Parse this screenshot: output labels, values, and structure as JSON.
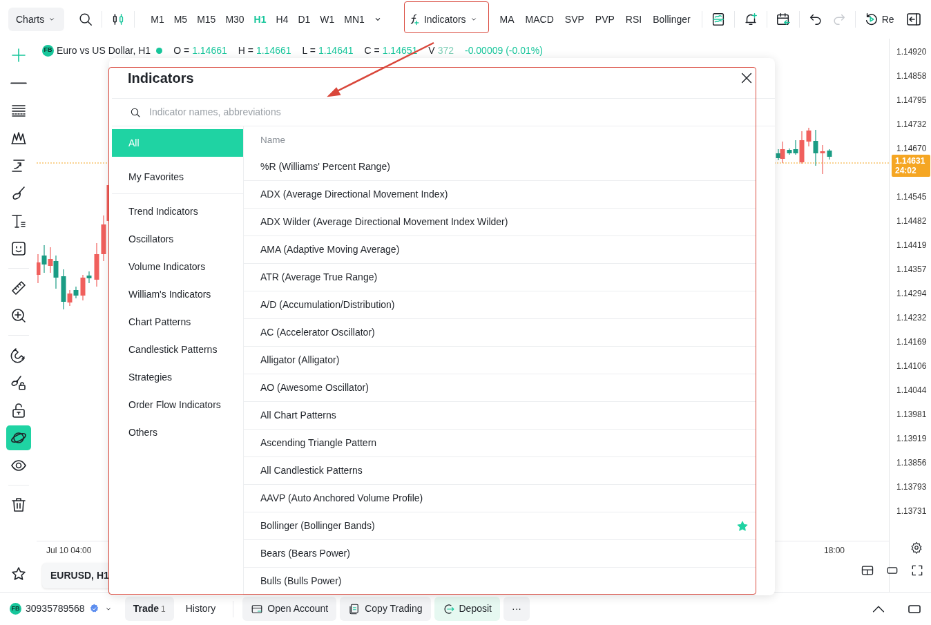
{
  "toolbar": {
    "charts_menu": "Charts",
    "timeframes": [
      {
        "label": "M1",
        "selected": false
      },
      {
        "label": "M5",
        "selected": false
      },
      {
        "label": "M15",
        "selected": false
      },
      {
        "label": "M30",
        "selected": false
      },
      {
        "label": "H1",
        "selected": true
      },
      {
        "label": "H4",
        "selected": false
      },
      {
        "label": "D1",
        "selected": false
      },
      {
        "label": "W1",
        "selected": false
      },
      {
        "label": "MN1",
        "selected": false
      }
    ],
    "indicators_button": "Indicators",
    "quick_indicators": [
      "MA",
      "MACD",
      "SVP",
      "PVP",
      "RSI",
      "Bollinger"
    ],
    "icons": [
      {
        "kind": "layout",
        "disabled": false
      },
      {
        "kind": "alert",
        "disabled": false
      },
      {
        "kind": "calendar",
        "disabled": false
      },
      {
        "kind": "undo",
        "disabled": false
      },
      {
        "kind": "redo",
        "disabled": true
      }
    ],
    "replay_label": "Re"
  },
  "drawing_tools": [
    [
      {
        "kind": "plus",
        "selected": false
      },
      {
        "kind": "line",
        "selected": false
      },
      {
        "kind": "lines",
        "selected": false
      },
      {
        "kind": "zigzag",
        "selected": false
      },
      {
        "kind": "arrow-line",
        "selected": false
      },
      {
        "kind": "brush",
        "selected": false
      },
      {
        "kind": "text",
        "selected": false
      },
      {
        "kind": "smiley",
        "selected": false
      }
    ],
    [
      {
        "kind": "ruler",
        "selected": false
      },
      {
        "kind": "zoom-in",
        "selected": false
      }
    ],
    [
      {
        "kind": "magnet",
        "selected": false
      },
      {
        "kind": "brush-lock",
        "selected": false
      },
      {
        "kind": "unlock",
        "selected": false
      },
      {
        "kind": "planet",
        "selected": true
      },
      {
        "kind": "eye",
        "selected": false
      }
    ],
    [
      {
        "kind": "trash",
        "selected": false
      }
    ]
  ],
  "symbol_bar": {
    "badge": "FB",
    "name": "Euro vs US Dollar, H1",
    "ohlc": [
      {
        "label": "O =",
        "value": "1.14661"
      },
      {
        "label": "H =",
        "value": "1.14661"
      },
      {
        "label": "L =",
        "value": "1.14641"
      },
      {
        "label": "C =",
        "value": "1.14651"
      }
    ],
    "volume_label": "V",
    "volume": "372",
    "change": "-0.00009 (-0.01%)"
  },
  "price_axis": {
    "ticks_above": [
      "1.14920",
      "1.14858",
      "1.14795",
      "1.14732",
      "1.14670"
    ],
    "ticks_below": [
      "1.14545",
      "1.14482",
      "1.14419",
      "1.14357",
      "1.14294",
      "1.14232",
      "1.14169",
      "1.14106",
      "1.14044",
      "1.13981",
      "1.13919",
      "1.13856",
      "1.13793",
      "1.13731"
    ],
    "current_price": "1.14631",
    "countdown": "24:02"
  },
  "time_axis": [
    "Jul 10 04:00",
    "18:00"
  ],
  "symbol_tab": "EURUSD, H1",
  "dialog": {
    "title": "Indicators",
    "search_placeholder": "Indicator names, abbreviations",
    "categories": [
      {
        "label": "All",
        "selected": true
      },
      {
        "label": "My Favorites",
        "selected": false
      },
      {
        "label": "Trend Indicators",
        "selected": false
      },
      {
        "label": "Oscillators",
        "selected": false
      },
      {
        "label": "Volume Indicators",
        "selected": false
      },
      {
        "label": "William's Indicators",
        "selected": false
      },
      {
        "label": "Chart Patterns",
        "selected": false
      },
      {
        "label": "Candlestick Patterns",
        "selected": false
      },
      {
        "label": "Strategies",
        "selected": false
      },
      {
        "label": "Order Flow Indicators",
        "selected": false
      },
      {
        "label": "Others",
        "selected": false
      }
    ],
    "column_header": "Name",
    "items": [
      {
        "name": "%R (Williams' Percent Range)",
        "favorite": false
      },
      {
        "name": "ADX (Average Directional Movement Index)",
        "favorite": false
      },
      {
        "name": "ADX Wilder (Average Directional Movement Index Wilder)",
        "favorite": false
      },
      {
        "name": "AMA (Adaptive Moving Average)",
        "favorite": false
      },
      {
        "name": "ATR (Average True Range)",
        "favorite": false
      },
      {
        "name": "A/D (Accumulation/Distribution)",
        "favorite": false
      },
      {
        "name": "AC (Accelerator Oscillator)",
        "favorite": false
      },
      {
        "name": "Alligator (Alligator)",
        "favorite": false
      },
      {
        "name": "AO (Awesome Oscillator)",
        "favorite": false
      },
      {
        "name": "All Chart Patterns",
        "favorite": false
      },
      {
        "name": "Ascending Triangle Pattern",
        "favorite": false
      },
      {
        "name": "All Candlestick Patterns",
        "favorite": false
      },
      {
        "name": "AAVP (Auto Anchored Volume Profile)",
        "favorite": false
      },
      {
        "name": "Bollinger (Bollinger Bands)",
        "favorite": true
      },
      {
        "name": "Bears (Bears Power)",
        "favorite": false
      },
      {
        "name": "Bulls (Bulls Power)",
        "favorite": false
      }
    ]
  },
  "bottom_bar": {
    "account_badge": "FB",
    "account": "30935789568",
    "tabs": [
      {
        "label": "Trade",
        "count": "1",
        "selected": true
      },
      {
        "label": "History",
        "selected": false
      }
    ],
    "actions": [
      {
        "kind": "open-account",
        "label": "Open Account"
      },
      {
        "kind": "copy-trading",
        "label": "Copy Trading"
      },
      {
        "kind": "deposit",
        "label": "Deposit"
      },
      {
        "kind": "more",
        "label": "···"
      }
    ]
  }
}
